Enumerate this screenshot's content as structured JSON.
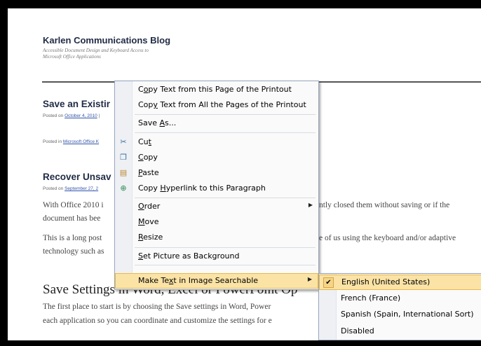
{
  "blog": {
    "title": "Karlen Communications Blog",
    "tagline": "Accessible Document Design and Keyboard Access to Microsoft Office Applications",
    "post1": {
      "title": "Save an Existir",
      "meta_prefix": "Posted on ",
      "meta_date": "October 4, 2010",
      "meta_suffix": " |",
      "posted_in_prefix": "Posted in ",
      "posted_in_link": "Microsoft Office K"
    },
    "post2": {
      "title": "Recover Unsav",
      "meta_prefix": "Posted on ",
      "meta_date": "September 27, 2"
    },
    "para1_line1_left": "With Office 2010 i",
    "para1_line1_right": "ntly closed them without saving or if the",
    "para1_line2": "document has bee",
    "para2_line1_left": "This is a long post",
    "para2_line1_right": "e of us using the keyboard and/or adaptive",
    "para2_line2": "technology such as",
    "heading_left": "Save Settings",
    "heading_right": "in Word, Excel or PowerPoint Op",
    "para3_line1": "The first place to start is by choosing the Save settings in Word, Power",
    "para3_line2": "each application so you can coordinate and customize the settings for e"
  },
  "context_menu": {
    "items": [
      {
        "pre": "C",
        "acc": "o",
        "post": "py Text from this Page of the Printout",
        "icon": ""
      },
      {
        "pre": "Cop",
        "acc": "y",
        "post": " Text from All the Pages of the Printout",
        "icon": ""
      },
      {
        "pre": "Save ",
        "acc": "A",
        "post": "s...",
        "icon": ""
      },
      {
        "pre": "Cu",
        "acc": "t",
        "post": "",
        "icon": "scissors-icon"
      },
      {
        "pre": "",
        "acc": "C",
        "post": "opy",
        "icon": "copy-icon"
      },
      {
        "pre": "",
        "acc": "P",
        "post": "aste",
        "icon": "paste-icon"
      },
      {
        "pre": "Copy ",
        "acc": "H",
        "post": "yperlink to this Paragraph",
        "icon": "hyperlink-icon"
      },
      {
        "pre": "",
        "acc": "O",
        "post": "rder",
        "icon": ""
      },
      {
        "pre": "",
        "acc": "M",
        "post": "ove",
        "icon": ""
      },
      {
        "pre": "",
        "acc": "R",
        "post": "esize",
        "icon": ""
      },
      {
        "pre": "",
        "acc": "S",
        "post": "et Picture as Background",
        "icon": ""
      },
      {
        "pre": "Make Te",
        "acc": "x",
        "post": "t in Image Searchable",
        "icon": ""
      }
    ]
  },
  "submenu": {
    "items": [
      {
        "label": "English (United States)",
        "checked": true
      },
      {
        "label": "French (France)",
        "checked": false
      },
      {
        "label": "Spanish (Spain, International Sort)",
        "checked": false
      },
      {
        "label": "Disabled",
        "checked": false
      }
    ]
  }
}
